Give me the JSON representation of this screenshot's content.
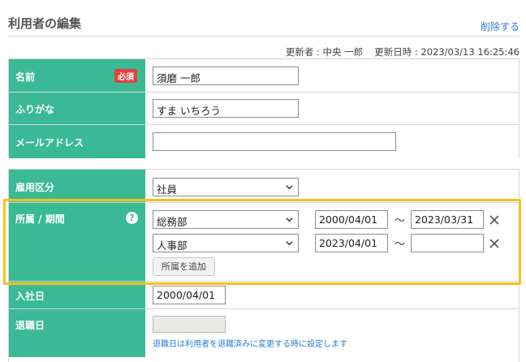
{
  "page": {
    "title": "利用者の編集",
    "delete_link": "削除する",
    "meta": {
      "updater_label": "更新者 : 中央 一郎",
      "updated_label": "更新日時 : 2023/03/13 16:25:46"
    }
  },
  "form": {
    "name": {
      "label": "名前",
      "required_badge": "必須",
      "value": "須磨 一郎"
    },
    "furigana": {
      "label": "ふりがな",
      "value": "すま いちろう"
    },
    "email": {
      "label": "メールアドレス",
      "value": ""
    },
    "employment": {
      "label": "雇用区分",
      "selected": "社員"
    },
    "affiliation": {
      "label": "所属 / 期間",
      "help_icon": "?",
      "rows": [
        {
          "department": "総務部",
          "start": "2000/04/01",
          "end": "2023/03/31"
        },
        {
          "department": "人事部",
          "start": "2023/04/01",
          "end": ""
        }
      ],
      "tilde": "〜",
      "add_button": "所属を追加"
    },
    "join_date": {
      "label": "入社日",
      "value": "2000/04/01"
    },
    "leave_date": {
      "label": "退職日",
      "value": "",
      "hint": "退職日は利用者を退職済みに変更する時に設定します"
    }
  },
  "colors": {
    "label_bg": "#3aba94",
    "required_badge": "#e8413b",
    "link": "#2a7bd6",
    "highlight": "#f6c11d"
  }
}
